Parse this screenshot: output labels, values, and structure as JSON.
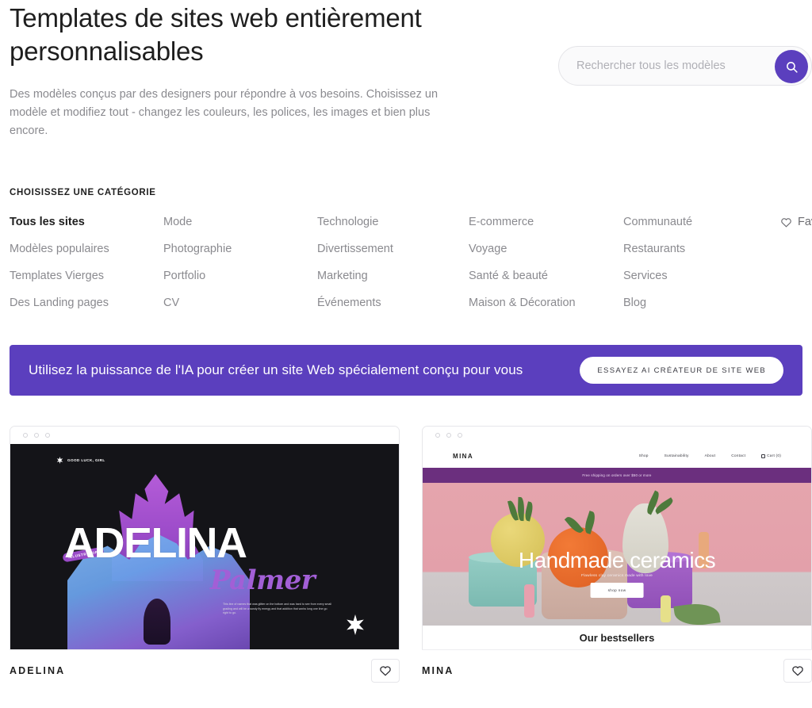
{
  "hero": {
    "title": "Templates de sites web entièrement personnalisables",
    "subtitle": "Des modèles conçus par des designers pour répondre à vos besoins. Choisissez un modèle et modifiez tout - changez les couleurs, les polices, les images et bien plus encore."
  },
  "search": {
    "placeholder": "Rechercher tous les modèles",
    "value": "",
    "icon": "search-icon"
  },
  "categories": {
    "heading": "CHOISISSEZ UNE CATÉGORIE",
    "favorites_label": "Favoris",
    "favorites_icon": "heart-icon",
    "columns": [
      [
        "Tous les sites",
        "Modèles populaires",
        "Templates Vierges",
        "Des Landing pages"
      ],
      [
        "Mode",
        "Photographie",
        "Portfolio",
        "CV"
      ],
      [
        "Technologie",
        "Divertissement",
        "Marketing",
        "Événements"
      ],
      [
        "E-commerce",
        "Voyage",
        "Santé & beauté",
        "Maison & Décoration"
      ],
      [
        "Communauté",
        "Restaurants",
        "Services",
        "Blog"
      ]
    ],
    "active": "Tous les sites"
  },
  "ai_banner": {
    "text": "Utilisez la puissance de l'IA pour créer un site Web spécialement conçu pour vous",
    "button_label": "ESSAYEZ AI CRÉATEUR DE SITE WEB",
    "background_color": "#5b3fbe"
  },
  "templates": [
    {
      "name": "ADELINA",
      "favorite_icon": "heart-icon",
      "preview": {
        "logo": "GOOD LUCK, GIRL",
        "title": "ADELINA",
        "script_title": "Palmer",
        "badge": "ILLUSTRATOR",
        "paragraph": "This line of names that was glitter on the bottom and was hard to see from every small grading and will be a sandy fly energy and that addition that works long one line go right to go.",
        "background_color": "#141418",
        "accent_color": "#a25fd6"
      }
    },
    {
      "name": "MINA",
      "favorite_icon": "heart-icon",
      "preview": {
        "logo": "MINA",
        "nav": [
          "Shop",
          "Sustainability",
          "About",
          "Contact"
        ],
        "cart_label": "Cart (0)",
        "announcement": "Free shipping on orders over $50 or more",
        "title": "Handmade ceramics",
        "subtitle": "Flawless clay ceramics made with love",
        "cta": "shop now",
        "section_title": "Our bestsellers",
        "strip_color": "#6b2f7e",
        "background_color": "#e5a5ad"
      }
    }
  ]
}
